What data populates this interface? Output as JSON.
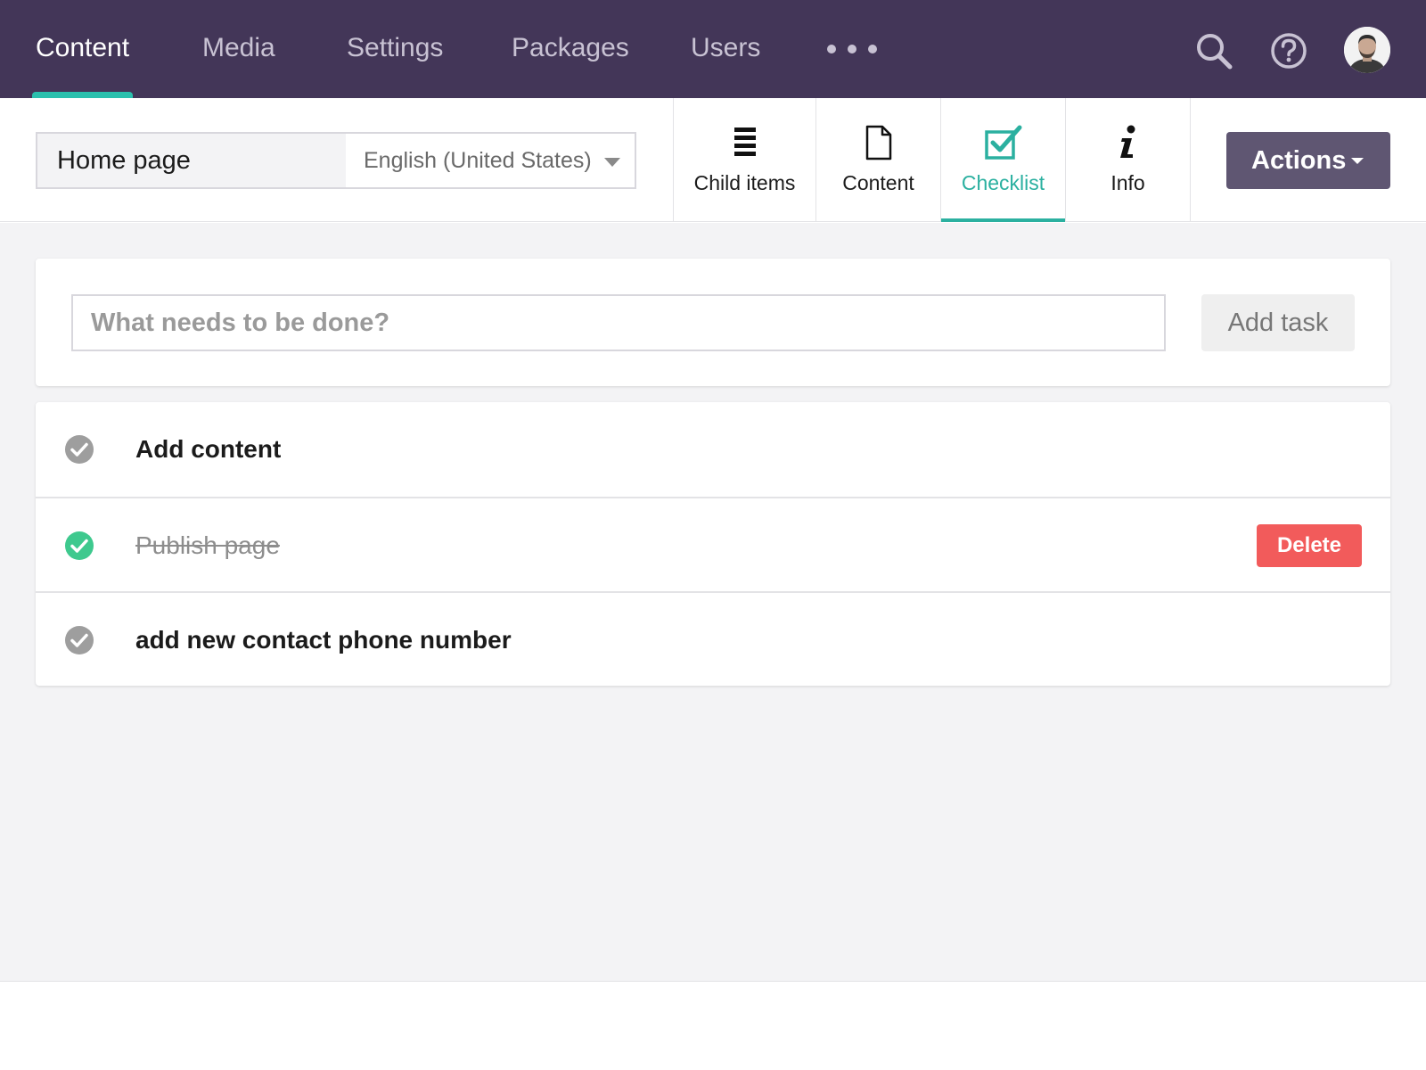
{
  "topnav": {
    "items": [
      {
        "label": "Content",
        "active": true
      },
      {
        "label": "Media"
      },
      {
        "label": "Settings"
      },
      {
        "label": "Packages"
      },
      {
        "label": "Users"
      }
    ],
    "more_icon": "ellipsis-icon",
    "icons": [
      "search-icon",
      "help-icon",
      "avatar"
    ]
  },
  "editor": {
    "node_name": "Home page",
    "language": "English (United States)",
    "tabs": [
      {
        "label": "Child items",
        "icon": "list-icon"
      },
      {
        "label": "Content",
        "icon": "document-icon"
      },
      {
        "label": "Checklist",
        "icon": "checkbox-icon",
        "active": true
      },
      {
        "label": "Info",
        "icon": "info-icon"
      }
    ],
    "actions_label": "Actions"
  },
  "checklist": {
    "input_placeholder": "What needs to be done?",
    "add_label": "Add task",
    "tasks": [
      {
        "text": "Add content",
        "done": false
      },
      {
        "text": "Publish page",
        "done": true,
        "delete_label": "Delete"
      },
      {
        "text": "add new contact phone number",
        "done": false
      }
    ]
  },
  "colors": {
    "topbar": "#433658",
    "accent": "#2bb0a0",
    "actions_button": "#5f5672",
    "done_check": "#3ec98e",
    "pending_check": "#9e9e9e",
    "delete_button": "#f25b5b"
  }
}
